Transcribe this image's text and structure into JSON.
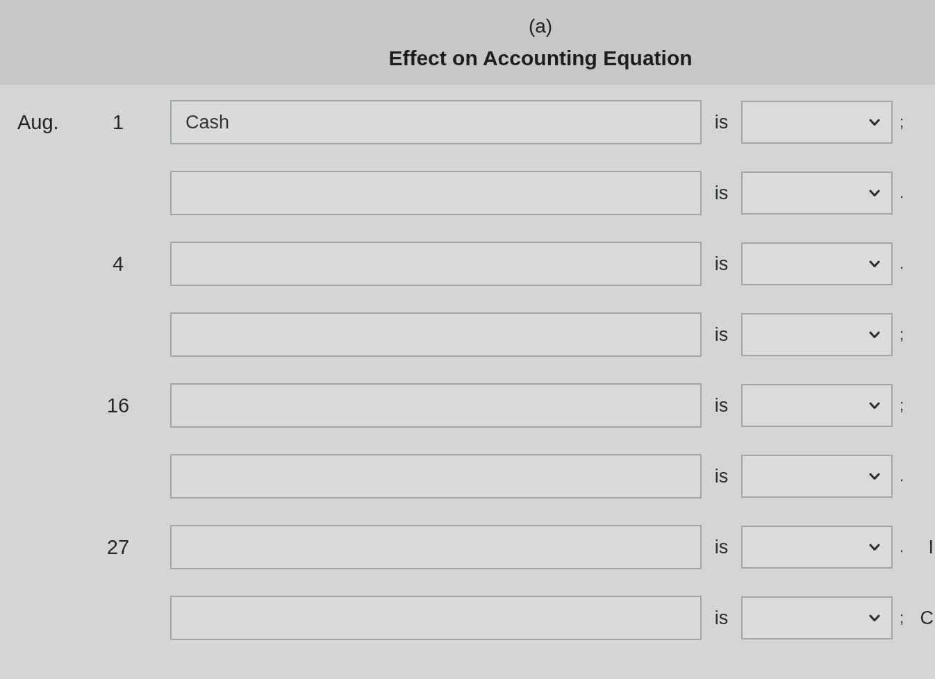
{
  "header": {
    "part_label": "(a)",
    "title": "Effect on Accounting Equation"
  },
  "rows": [
    {
      "month": "Aug.",
      "day": "1",
      "account": "Cash",
      "verb": "is",
      "end_mark": ";"
    },
    {
      "verb": "is",
      "end_mark": "."
    },
    {
      "day": "4",
      "verb": "is",
      "end_mark": "."
    },
    {
      "verb": "is",
      "end_mark": ";"
    },
    {
      "day": "16",
      "verb": "is",
      "end_mark": ";"
    },
    {
      "verb": "is",
      "end_mark": "."
    },
    {
      "day": "27",
      "verb": "is",
      "end_mark": ".",
      "trailing": "I"
    },
    {
      "verb": "is",
      "end_mark": ";",
      "trailing": "C"
    }
  ]
}
